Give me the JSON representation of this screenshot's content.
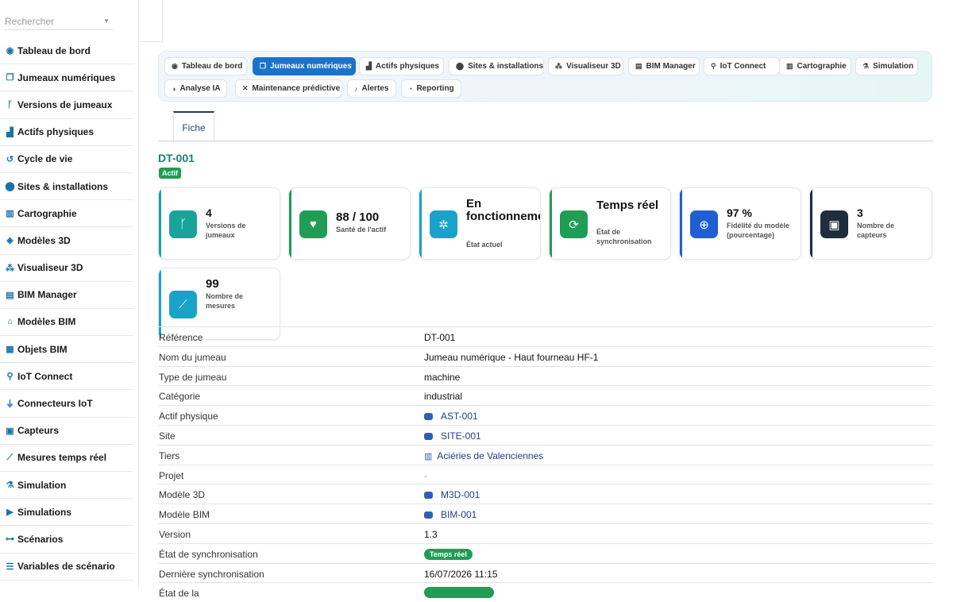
{
  "search": {
    "placeholder": "Rechercher"
  },
  "sidebar": {
    "items": [
      {
        "label": "Tableau de bord",
        "icon": "dashboard-icon"
      },
      {
        "label": "Jumeaux numériques",
        "icon": "copy-icon"
      },
      {
        "label": "Versions de jumeaux",
        "icon": "branch-icon"
      },
      {
        "label": "Actifs physiques",
        "icon": "industry-icon"
      },
      {
        "label": "Cycle de vie",
        "icon": "history-icon"
      },
      {
        "label": "Sites & installations",
        "icon": "map-marker-icon"
      },
      {
        "label": "Cartographie",
        "icon": "map-icon"
      },
      {
        "label": "Modèles 3D",
        "icon": "cube-icon"
      },
      {
        "label": "Visualiseur 3D",
        "icon": "cubes-icon"
      },
      {
        "label": "BIM Manager",
        "icon": "building-icon"
      },
      {
        "label": "Modèles BIM",
        "icon": "warehouse-icon"
      },
      {
        "label": "Objets BIM",
        "icon": "grid-icon"
      },
      {
        "label": "IoT Connect",
        "icon": "broadcast-icon"
      },
      {
        "label": "Connecteurs IoT",
        "icon": "plug-icon"
      },
      {
        "label": "Capteurs",
        "icon": "chip-icon"
      },
      {
        "label": "Mesures temps réel",
        "icon": "chart-line-icon"
      },
      {
        "label": "Simulation",
        "icon": "flask-icon"
      },
      {
        "label": "Simulations",
        "icon": "play-circle-icon"
      },
      {
        "label": "Scénarios",
        "icon": "project-diagram-icon"
      },
      {
        "label": "Variables de scénario",
        "icon": "sliders-icon"
      }
    ]
  },
  "tabs": [
    {
      "label": "Tableau de bord",
      "icon": "dashboard-icon",
      "active": false
    },
    {
      "label": "Jumeaux numériques",
      "icon": "copy-icon",
      "active": true
    },
    {
      "label": "Actifs physiques",
      "icon": "industry-icon",
      "active": false
    },
    {
      "label": "Sites & installations",
      "icon": "map-marker-icon",
      "active": false
    },
    {
      "label": "Visualiseur 3D",
      "icon": "cubes-icon",
      "active": false
    },
    {
      "label": "BIM Manager",
      "icon": "building-icon",
      "active": false
    },
    {
      "label": "IoT Connect",
      "icon": "broadcast-icon",
      "active": false
    },
    {
      "label": "Cartographie",
      "icon": "map-icon",
      "active": false
    },
    {
      "label": "Simulation",
      "icon": "flask-icon",
      "active": false
    },
    {
      "label": "Analyse IA",
      "icon": "brain-icon",
      "active": false
    },
    {
      "label": "Maintenance prédictive",
      "icon": "tools-icon",
      "active": false
    },
    {
      "label": "Alertes",
      "icon": "bell-icon",
      "active": false
    },
    {
      "label": "Reporting",
      "icon": "pie-chart-icon",
      "active": false
    }
  ],
  "subtab": {
    "label": "Fiche"
  },
  "record": {
    "ref": "DT-001",
    "status": "Actif"
  },
  "colors": {
    "accent": "#1a73c8",
    "teal": "#17807a",
    "green": "#1f9d55"
  },
  "kpis": [
    {
      "value": "4",
      "label": "Versions de jumeaux",
      "icon": "branch-icon",
      "color": "#1aa39a"
    },
    {
      "value": "88 / 100",
      "label": "Santé de l'actif",
      "icon": "heartbeat-icon",
      "color": "#1f9d55"
    },
    {
      "value": "En fonctionnement",
      "label": "État actuel",
      "icon": "cog-icon",
      "color": "#1aa3c8"
    },
    {
      "value": "Temps réel",
      "label": "État de synchronisation",
      "icon": "sync-icon",
      "color": "#1f9d55"
    },
    {
      "value": "97 %",
      "label": "Fidélité du modèle (pourcentage)",
      "icon": "crosshairs-icon",
      "color": "#1f5fd1"
    },
    {
      "value": "3",
      "label": "Nombre de capteurs",
      "icon": "chip-icon",
      "color": "#1f2d3d"
    },
    {
      "value": "99",
      "label": "Nombre de mesures",
      "icon": "chart-line-icon",
      "color": "#1aa3c8"
    }
  ],
  "fields": [
    {
      "key": "Référence",
      "value": "DT-001",
      "type": "text"
    },
    {
      "key": "Nom du jumeau",
      "value": "Jumeau numérique - Haut fourneau HF-1",
      "type": "text"
    },
    {
      "key": "Type de jumeau",
      "value": "machine",
      "type": "text"
    },
    {
      "key": "Catégorie",
      "value": "industrial",
      "type": "text"
    },
    {
      "key": "Actif physique",
      "value": "AST-001",
      "type": "link"
    },
    {
      "key": "Site",
      "value": "SITE-001",
      "type": "link"
    },
    {
      "key": "Tiers",
      "value": "Aciéries de Valenciennes",
      "type": "company"
    },
    {
      "key": "Projet",
      "value": "-",
      "type": "muted"
    },
    {
      "key": "Modèle 3D",
      "value": "M3D-001",
      "type": "link"
    },
    {
      "key": "Modèle BIM",
      "value": "BIM-001",
      "type": "link"
    },
    {
      "key": "Version",
      "value": "1.3",
      "type": "text"
    },
    {
      "key": "État de synchronisation",
      "value": "Temps réel",
      "type": "pill"
    },
    {
      "key": "Dernière synchronisation",
      "value": "16/07/2026 11:15",
      "type": "text"
    },
    {
      "key": "État de la",
      "value": "",
      "type": "pill-cut"
    }
  ]
}
